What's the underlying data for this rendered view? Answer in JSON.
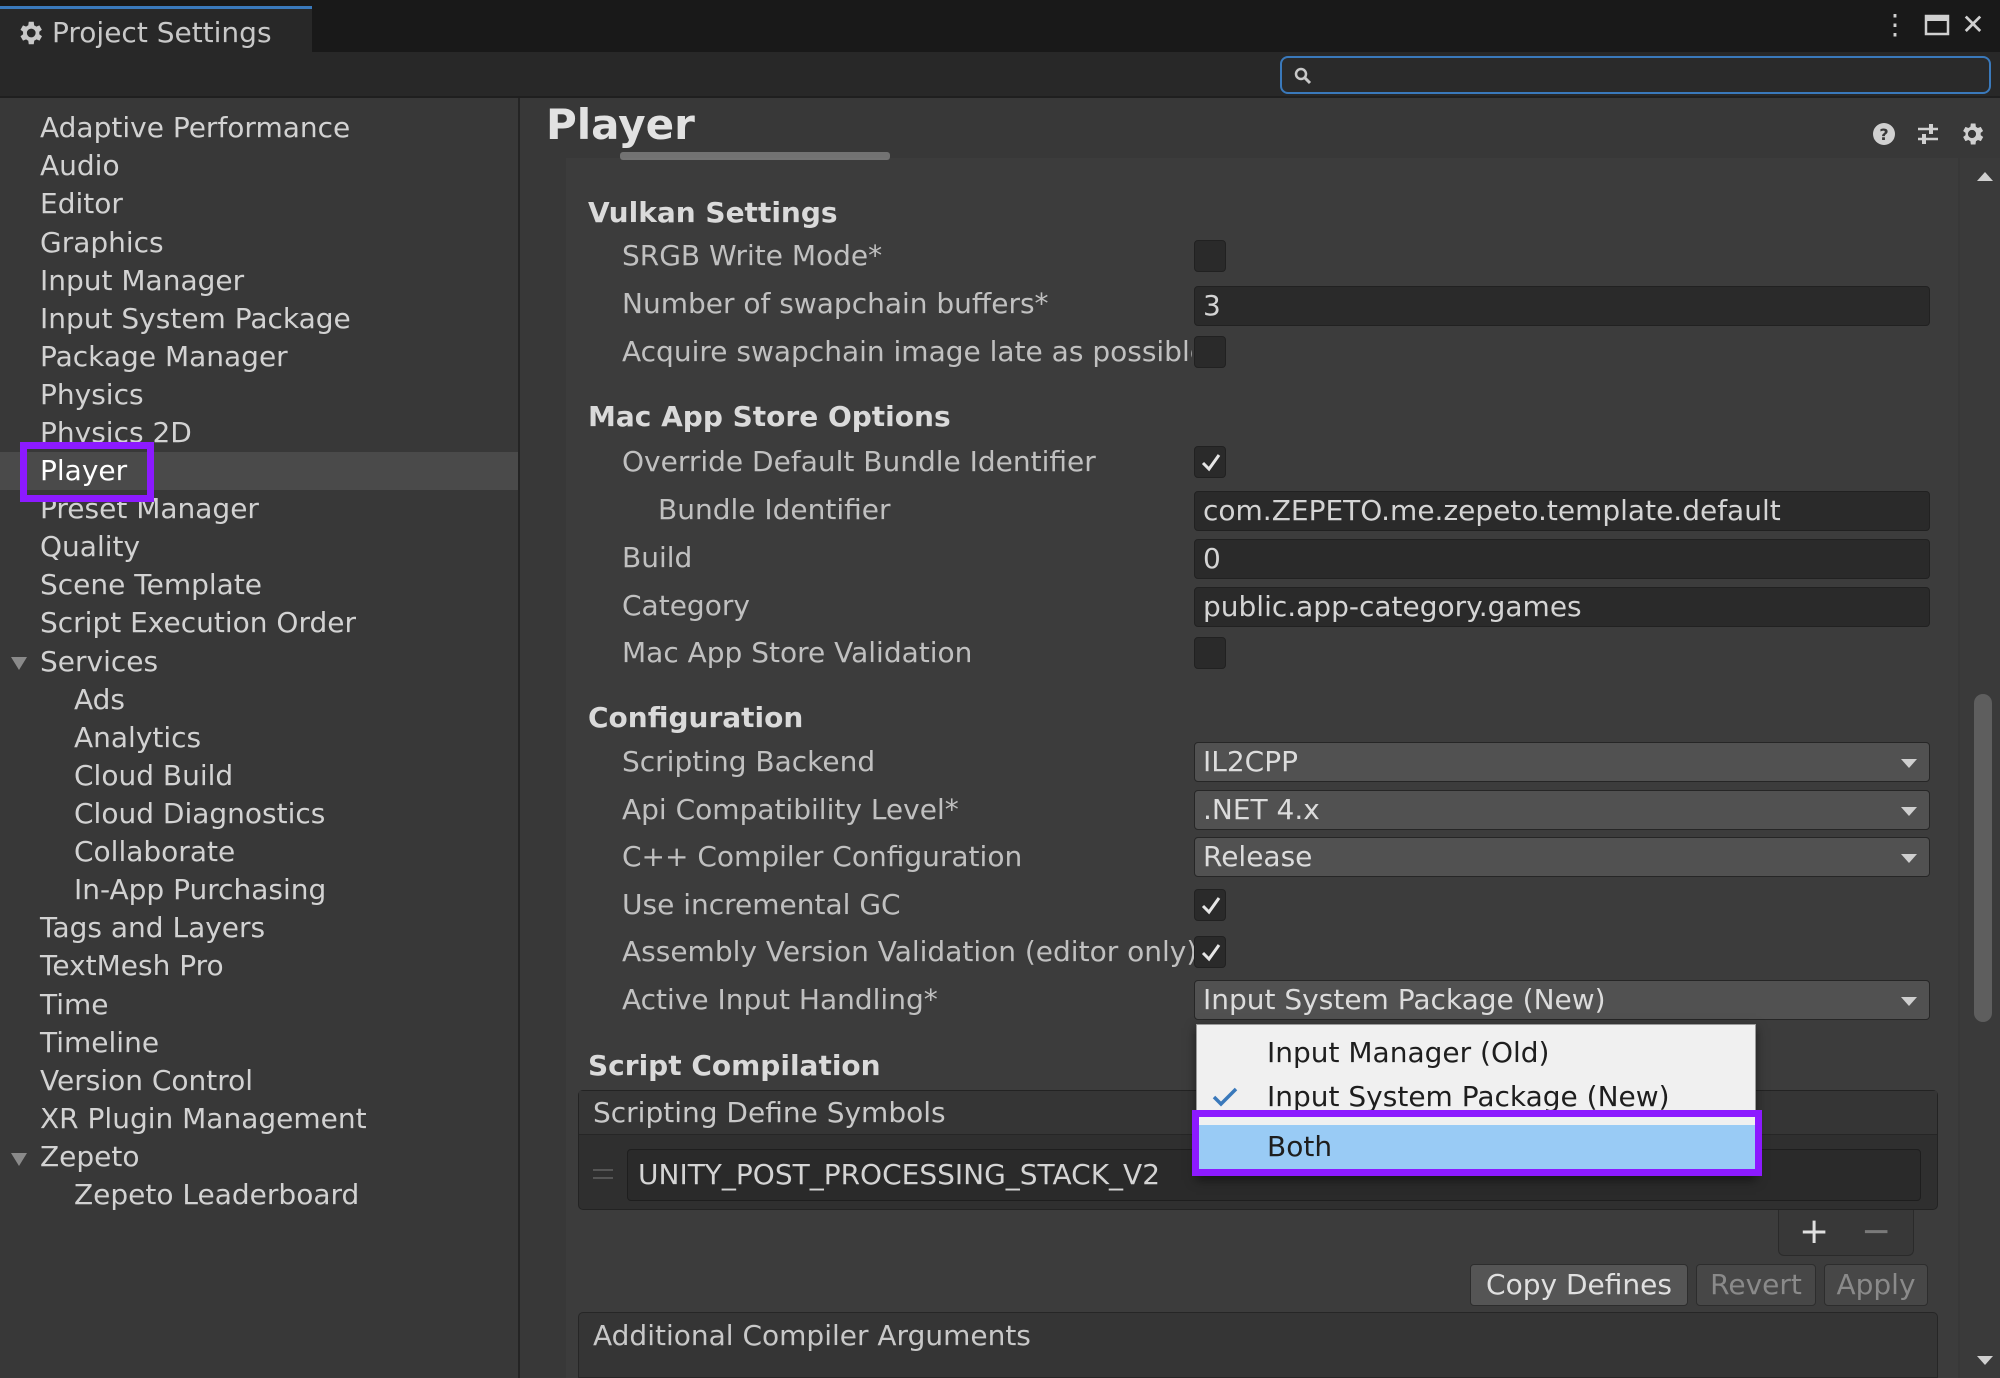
{
  "window": {
    "tab_title": "Project Settings",
    "menu_glyph": "⋮",
    "maximize_glyph": "🗖",
    "close_glyph": "✕"
  },
  "search": {
    "value": "",
    "placeholder": ""
  },
  "sidebar": {
    "items": [
      {
        "label": "Adaptive Performance"
      },
      {
        "label": "Audio"
      },
      {
        "label": "Editor"
      },
      {
        "label": "Graphics"
      },
      {
        "label": "Input Manager"
      },
      {
        "label": "Input System Package"
      },
      {
        "label": "Package Manager"
      },
      {
        "label": "Physics"
      },
      {
        "label": "Physics 2D"
      },
      {
        "label": "Player"
      },
      {
        "label": "Preset Manager"
      },
      {
        "label": "Quality"
      },
      {
        "label": "Scene Template"
      },
      {
        "label": "Script Execution Order"
      },
      {
        "label": "Services"
      },
      {
        "label": "Ads"
      },
      {
        "label": "Analytics"
      },
      {
        "label": "Cloud Build"
      },
      {
        "label": "Cloud Diagnostics"
      },
      {
        "label": "Collaborate"
      },
      {
        "label": "In-App Purchasing"
      },
      {
        "label": "Tags and Layers"
      },
      {
        "label": "TextMesh Pro"
      },
      {
        "label": "Time"
      },
      {
        "label": "Timeline"
      },
      {
        "label": "Version Control"
      },
      {
        "label": "XR Plugin Management"
      },
      {
        "label": "Zepeto"
      },
      {
        "label": "Zepeto Leaderboard"
      }
    ],
    "selected": "Player"
  },
  "main": {
    "title": "Player",
    "vulkan": {
      "header": "Vulkan Settings",
      "srgb_label": "SRGB Write Mode*",
      "srgb_checked": false,
      "swapchain_label": "Number of swapchain buffers*",
      "swapchain_value": "3",
      "acquire_label": "Acquire swapchain image late as possible",
      "acquire_checked": false
    },
    "mac": {
      "header": "Mac App Store Options",
      "override_label": "Override Default Bundle Identifier",
      "override_checked": true,
      "bundle_label": "Bundle Identifier",
      "bundle_value": "com.ZEPETO.me.zepeto.template.default",
      "build_label": "Build",
      "build_value": "0",
      "category_label": "Category",
      "category_value": "public.app-category.games",
      "validation_label": "Mac App Store Validation",
      "validation_checked": false
    },
    "config": {
      "header": "Configuration",
      "backend_label": "Scripting Backend",
      "backend_value": "IL2CPP",
      "api_label": "Api Compatibility Level*",
      "api_value": ".NET 4.x",
      "cpp_label": "C++ Compiler Configuration",
      "cpp_value": "Release",
      "gc_label": "Use incremental GC",
      "gc_checked": true,
      "assembly_label": "Assembly Version Validation (editor only)",
      "assembly_checked": true,
      "input_label": "Active Input Handling*",
      "input_value": "Input System Package (New)"
    },
    "compilation": {
      "header": "Script Compilation",
      "defines_header": "Scripting Define Symbols",
      "define_value": "UNITY_POST_PROCESSING_STACK_V2",
      "plus": "+",
      "minus": "−",
      "copy_label": "Copy Defines",
      "revert_label": "Revert",
      "apply_label": "Apply",
      "additional_header": "Additional Compiler Arguments"
    }
  },
  "popup": {
    "options": [
      {
        "label": "Input Manager (Old)",
        "checked": false
      },
      {
        "label": "Input System Package (New)",
        "checked": true
      },
      {
        "label": "Both",
        "checked": false,
        "highlighted": true
      }
    ]
  },
  "colors": {
    "highlight_outline": "#8c1aff",
    "menu_highlight": "#99cbf5",
    "accent": "#3a79bb"
  }
}
